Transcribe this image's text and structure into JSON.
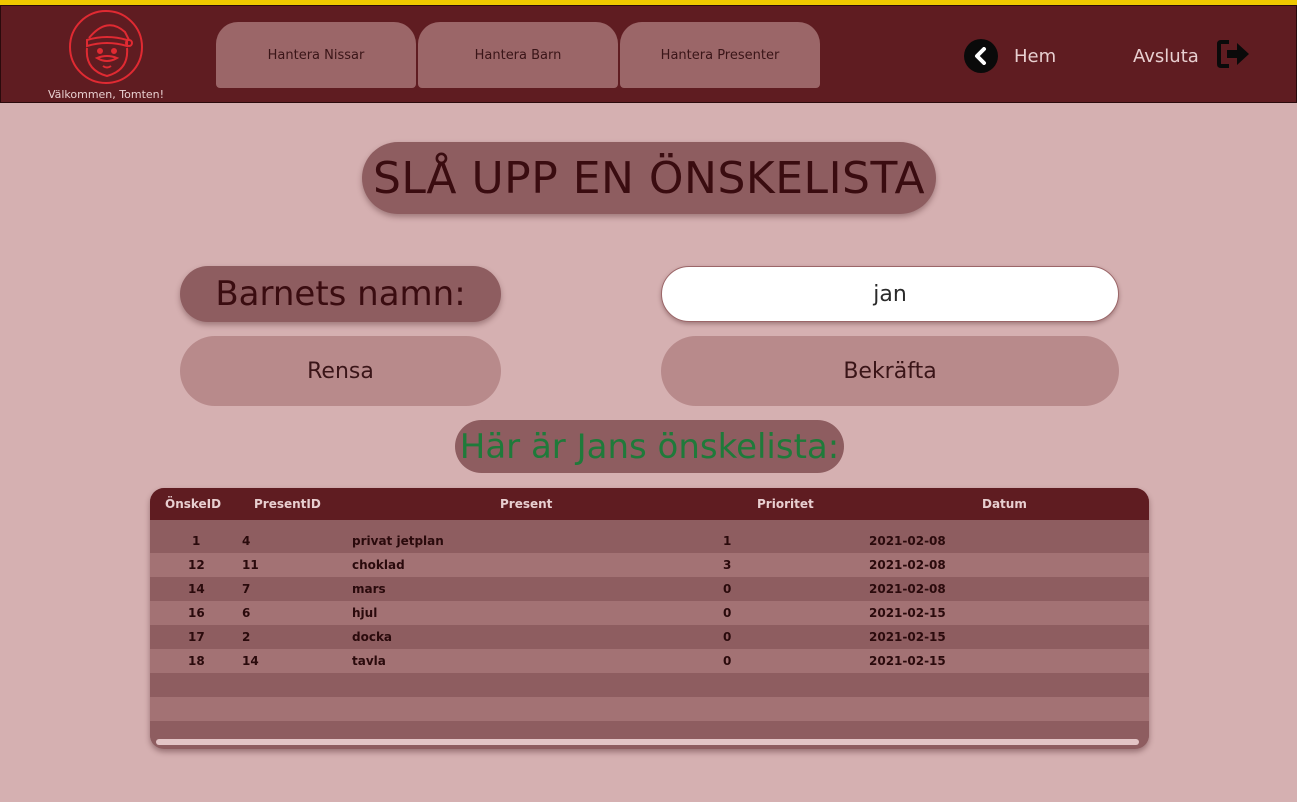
{
  "header": {
    "welcome": "Välkommen, Tomten!",
    "tabs": [
      "Hantera Nissar",
      "Hantera Barn",
      "Hantera Presenter"
    ],
    "home_label": "Hem",
    "logout_label": "Avsluta"
  },
  "page": {
    "title": "SLÅ UPP EN ÖNSKELISTA",
    "name_label": "Barnets namn:",
    "name_value": "jan",
    "clear_label": "Rensa",
    "confirm_label": "Bekräfta",
    "result_title": "Här är Jans önskelista:"
  },
  "table": {
    "columns": [
      "ÖnskeID",
      "PresentID",
      "Present",
      "Prioritet",
      "Datum"
    ],
    "rows": [
      {
        "onskeid": "1",
        "presentid": "4",
        "present": "privat jetplan",
        "prioritet": "1",
        "datum": "2021-02-08"
      },
      {
        "onskeid": "12",
        "presentid": "11",
        "present": "choklad",
        "prioritet": "3",
        "datum": "2021-02-08"
      },
      {
        "onskeid": "14",
        "presentid": "7",
        "present": "mars",
        "prioritet": "0",
        "datum": "2021-02-08"
      },
      {
        "onskeid": "16",
        "presentid": "6",
        "present": "hjul",
        "prioritet": "0",
        "datum": "2021-02-15"
      },
      {
        "onskeid": "17",
        "presentid": "2",
        "present": "docka",
        "prioritet": "0",
        "datum": "2021-02-15"
      },
      {
        "onskeid": "18",
        "presentid": "14",
        "present": "tavla",
        "prioritet": "0",
        "datum": "2021-02-15"
      }
    ]
  },
  "icons": {
    "logo": "santa-face-icon",
    "home": "back-arrow-circle-icon",
    "logout": "sign-out-icon"
  },
  "colors": {
    "header_bg": "#5f1c21",
    "page_bg": "#d5b0b1",
    "accent_green": "#1f7a3a",
    "logo_red": "#e02a32"
  }
}
